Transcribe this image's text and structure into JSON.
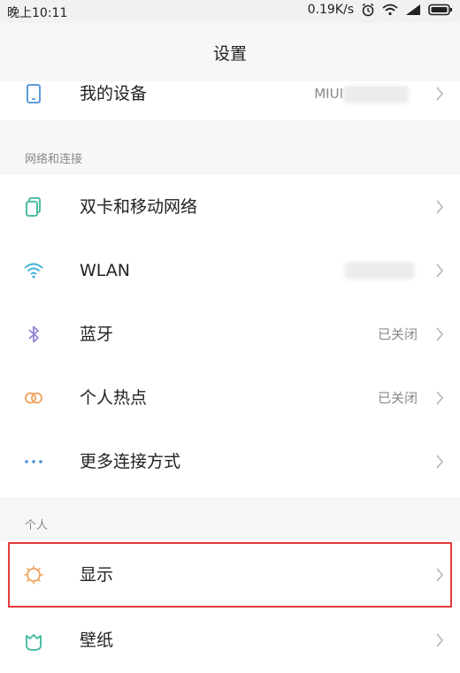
{
  "status_bar": {
    "time": "晚上10:11",
    "speed": "0.19K/s"
  },
  "title": "设置",
  "device": {
    "label": "我的设备",
    "value": "MIUI"
  },
  "sections": {
    "network": "网络和连接",
    "personal": "个人"
  },
  "network_items": [
    {
      "label": "双卡和移动网络",
      "value": "",
      "icon": "sim-cards-icon"
    },
    {
      "label": "WLAN",
      "value": "",
      "icon": "wifi-icon"
    },
    {
      "label": "蓝牙",
      "value": "已关闭",
      "icon": "bluetooth-icon"
    },
    {
      "label": "个人热点",
      "value": "已关闭",
      "icon": "hotspot-icon"
    },
    {
      "label": "更多连接方式",
      "value": "",
      "icon": "more-dots-icon"
    }
  ],
  "personal_items": [
    {
      "label": "显示",
      "value": "",
      "icon": "display-brightness-icon"
    },
    {
      "label": "壁纸",
      "value": "",
      "icon": "wallpaper-icon"
    }
  ],
  "colors": {
    "highlight": "#e03b3b",
    "accent_teal": "#3bb79b",
    "accent_blue": "#4a90d9"
  }
}
